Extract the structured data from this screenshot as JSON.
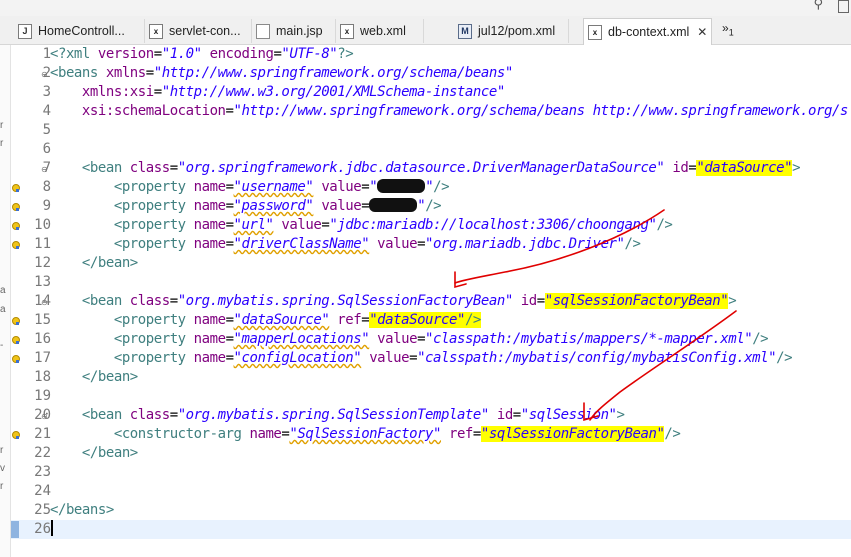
{
  "tabs": [
    {
      "label": "HomeControll...",
      "icon": "java-file-icon"
    },
    {
      "label": "servlet-con...",
      "icon": "xml-file-icon"
    },
    {
      "label": "main.jsp",
      "icon": "jsp-file-icon"
    },
    {
      "label": "web.xml",
      "icon": "xml-file-icon"
    },
    {
      "label": "jul12/pom.xml",
      "icon": "maven-pom-icon"
    },
    {
      "label": "db-context.xml",
      "icon": "xml-file-icon",
      "active": true
    }
  ],
  "tab_close": "✕",
  "overflow": {
    "symbol": "»",
    "count": "1"
  },
  "editor": {
    "lines": [
      {
        "n": "1"
      },
      {
        "n": "2"
      },
      {
        "n": "3"
      },
      {
        "n": "4"
      },
      {
        "n": "5"
      },
      {
        "n": "6"
      },
      {
        "n": "7"
      },
      {
        "n": "8"
      },
      {
        "n": "9"
      },
      {
        "n": "10"
      },
      {
        "n": "11"
      },
      {
        "n": "12"
      },
      {
        "n": "13"
      },
      {
        "n": "14"
      },
      {
        "n": "15"
      },
      {
        "n": "16"
      },
      {
        "n": "17"
      },
      {
        "n": "18"
      },
      {
        "n": "19"
      },
      {
        "n": "20"
      },
      {
        "n": "21"
      },
      {
        "n": "22"
      },
      {
        "n": "23"
      },
      {
        "n": "24"
      },
      {
        "n": "25"
      },
      {
        "n": "26"
      }
    ],
    "code": {
      "l1": {
        "open": "<?xml ",
        "a1": "version",
        "eq1": "=",
        "v1": "\"1.0\"",
        "a2": " encoding",
        "eq2": "=",
        "v2": "\"UTF-8\"",
        "close": "?>"
      },
      "l2": {
        "open": "<beans ",
        "a1": "xmlns",
        "eq": "=",
        "v1": "\"http://www.springframework.org/schema/beans\""
      },
      "l3": {
        "a1": "xmlns:xsi",
        "eq": "=",
        "v1": "\"http://www.w3.org/2001/XMLSchema-instance\""
      },
      "l4": {
        "a1": "xsi:schemaLocation",
        "eq": "=",
        "v1": "\"http://www.springframework.org/schema/beans http://www.springframework.org/s"
      },
      "l7": {
        "open": "<bean ",
        "a1": "class",
        "eq1": "=",
        "v1": "\"org.springframework.jdbc.datasource.DriverManagerDataSource\"",
        "a2": " id",
        "eq2": "=",
        "v2": "\"dataSource\"",
        "close": ">"
      },
      "l8": {
        "open": "<property ",
        "a1": "name",
        "eq1": "=",
        "v1": "\"username\"",
        "a2": " value",
        "eq2": "=",
        "v2a": "\"",
        "v2b": "\"",
        "close": "/>"
      },
      "l9": {
        "open": "<property ",
        "a1": "name",
        "eq1": "=",
        "v1": "\"password\"",
        "a2": " value",
        "eq2": "=",
        "v2a": "",
        "v2b": "\"",
        "close": "/>"
      },
      "l10": {
        "open": "<property ",
        "a1": "name",
        "eq1": "=",
        "v1": "\"url\"",
        "a2": " value",
        "eq2": "=",
        "v2": "\"jdbc:mariadb://localhost:3306/choongang\"",
        "close": "/>"
      },
      "l11": {
        "open": "<property ",
        "a1": "name",
        "eq1": "=",
        "v1": "\"driverClassName\"",
        "a2": " value",
        "eq2": "=",
        "v2": "\"org.mariadb.jdbc.Driver\"",
        "close": "/>"
      },
      "l12": {
        "text": "</bean>"
      },
      "l14": {
        "open": "<bean ",
        "a1": "class",
        "eq1": "=",
        "v1": "\"org.mybatis.spring.SqlSessionFactoryBean\"",
        "a2": " id",
        "eq2": "=",
        "v2": "\"sqlSessionFactoryBean\"",
        "close": ">"
      },
      "l15": {
        "open": "<property ",
        "a1": "name",
        "eq1": "=",
        "v1": "\"dataSource\"",
        "a2": " ref",
        "eq2": "=",
        "v2": "\"dataSource\"",
        "close": "/>"
      },
      "l16": {
        "open": "<property ",
        "a1": "name",
        "eq1": "=",
        "v1": "\"mapperLocations\"",
        "a2": " value",
        "eq2": "=",
        "v2": "\"classpath:/mybatis/mappers/*-mapper.xml\"",
        "close": "/>"
      },
      "l17": {
        "open": "<property ",
        "a1": "name",
        "eq1": "=",
        "v1": "\"configLocation\"",
        "a2": " value",
        "eq2": "=",
        "v2": "\"calsspath:/mybatis/config/mybatisConfig.xml\"",
        "close": "/>"
      },
      "l18": {
        "text": "</bean>"
      },
      "l20": {
        "open": "<bean ",
        "a1": "class",
        "eq1": "=",
        "v1": "\"org.mybatis.spring.SqlSessionTemplate\"",
        "a2": " id",
        "eq2": "=",
        "v2": "\"sqlSession\"",
        "close": ">"
      },
      "l21": {
        "open": "<constructor-arg ",
        "a1": "name",
        "eq1": "=",
        "v1": "\"SqlSessionFactory\"",
        "a2": " ref",
        "eq2": "=",
        "v2": "\"sqlSessionFactoryBean\"",
        "close": "/>"
      },
      "l22": {
        "text": "</bean>"
      },
      "l25": {
        "text": "</beans>"
      }
    }
  },
  "colors": {
    "tag": "#3f7f7f",
    "attribute": "#7f007f",
    "value": "#2a00ff",
    "highlight": "#ffff00",
    "annotation": "#e00000",
    "current_line": "#e8f2fe"
  }
}
